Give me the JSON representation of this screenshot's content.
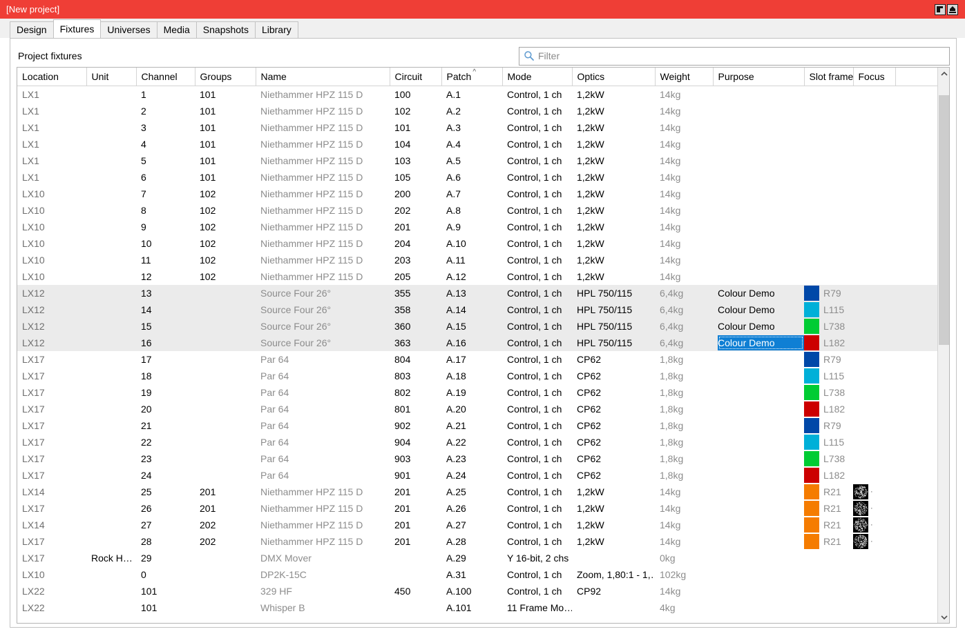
{
  "window": {
    "title": "[New project]",
    "accent_color": "#ef3e36",
    "buttons": [
      {
        "name": "restore-down-button",
        "glyph": "◤"
      },
      {
        "name": "maximize-button",
        "glyph": "⌂"
      }
    ]
  },
  "tabs": [
    {
      "label": "Design",
      "active": false
    },
    {
      "label": "Fixtures",
      "active": true
    },
    {
      "label": "Universes",
      "active": false
    },
    {
      "label": "Media",
      "active": false
    },
    {
      "label": "Snapshots",
      "active": false
    },
    {
      "label": "Library",
      "active": false
    }
  ],
  "panel": {
    "section_label": "Project fixtures",
    "filter": {
      "placeholder": "Filter",
      "value": ""
    }
  },
  "table": {
    "columns": [
      "Location",
      "Unit",
      "Channel",
      "Groups",
      "Name",
      "Circuit",
      "Patch",
      "Mode",
      "Optics",
      "Weight",
      "Purpose",
      "Slot frames",
      "Focus"
    ],
    "sorted_column": "Patch",
    "sort_direction": "asc",
    "colors": {
      "R79": "#0048a8",
      "L115": "#00b0d8",
      "L738": "#00cc33",
      "L182": "#cc0000",
      "R21": "#f57c00"
    },
    "rows": [
      {
        "location": "LX1",
        "unit": "",
        "channel": "1",
        "groups": "101",
        "name": "Niethammer HPZ 115 D",
        "circuit": "100",
        "patch": "A.1",
        "mode": "Control, 1 ch",
        "optics": "1,2kW",
        "weight": "14kg",
        "purpose": "",
        "slot_frame": "",
        "slot_color": "",
        "focus": "",
        "selected": false,
        "cell_selected": false
      },
      {
        "location": "LX1",
        "unit": "",
        "channel": "2",
        "groups": "101",
        "name": "Niethammer HPZ 115 D",
        "circuit": "102",
        "patch": "A.2",
        "mode": "Control, 1 ch",
        "optics": "1,2kW",
        "weight": "14kg",
        "purpose": "",
        "slot_frame": "",
        "slot_color": "",
        "focus": "",
        "selected": false,
        "cell_selected": false
      },
      {
        "location": "LX1",
        "unit": "",
        "channel": "3",
        "groups": "101",
        "name": "Niethammer HPZ 115 D",
        "circuit": "101",
        "patch": "A.3",
        "mode": "Control, 1 ch",
        "optics": "1,2kW",
        "weight": "14kg",
        "purpose": "",
        "slot_frame": "",
        "slot_color": "",
        "focus": "",
        "selected": false,
        "cell_selected": false
      },
      {
        "location": "LX1",
        "unit": "",
        "channel": "4",
        "groups": "101",
        "name": "Niethammer HPZ 115 D",
        "circuit": "104",
        "patch": "A.4",
        "mode": "Control, 1 ch",
        "optics": "1,2kW",
        "weight": "14kg",
        "purpose": "",
        "slot_frame": "",
        "slot_color": "",
        "focus": "",
        "selected": false,
        "cell_selected": false
      },
      {
        "location": "LX1",
        "unit": "",
        "channel": "5",
        "groups": "101",
        "name": "Niethammer HPZ 115 D",
        "circuit": "103",
        "patch": "A.5",
        "mode": "Control, 1 ch",
        "optics": "1,2kW",
        "weight": "14kg",
        "purpose": "",
        "slot_frame": "",
        "slot_color": "",
        "focus": "",
        "selected": false,
        "cell_selected": false
      },
      {
        "location": "LX1",
        "unit": "",
        "channel": "6",
        "groups": "101",
        "name": "Niethammer HPZ 115 D",
        "circuit": "105",
        "patch": "A.6",
        "mode": "Control, 1 ch",
        "optics": "1,2kW",
        "weight": "14kg",
        "purpose": "",
        "slot_frame": "",
        "slot_color": "",
        "focus": "",
        "selected": false,
        "cell_selected": false
      },
      {
        "location": "LX10",
        "unit": "",
        "channel": "7",
        "groups": "102",
        "name": "Niethammer HPZ 115 D",
        "circuit": "200",
        "patch": "A.7",
        "mode": "Control, 1 ch",
        "optics": "1,2kW",
        "weight": "14kg",
        "purpose": "",
        "slot_frame": "",
        "slot_color": "",
        "focus": "",
        "selected": false,
        "cell_selected": false
      },
      {
        "location": "LX10",
        "unit": "",
        "channel": "8",
        "groups": "102",
        "name": "Niethammer HPZ 115 D",
        "circuit": "202",
        "patch": "A.8",
        "mode": "Control, 1 ch",
        "optics": "1,2kW",
        "weight": "14kg",
        "purpose": "",
        "slot_frame": "",
        "slot_color": "",
        "focus": "",
        "selected": false,
        "cell_selected": false
      },
      {
        "location": "LX10",
        "unit": "",
        "channel": "9",
        "groups": "102",
        "name": "Niethammer HPZ 115 D",
        "circuit": "201",
        "patch": "A.9",
        "mode": "Control, 1 ch",
        "optics": "1,2kW",
        "weight": "14kg",
        "purpose": "",
        "slot_frame": "",
        "slot_color": "",
        "focus": "",
        "selected": false,
        "cell_selected": false
      },
      {
        "location": "LX10",
        "unit": "",
        "channel": "10",
        "groups": "102",
        "name": "Niethammer HPZ 115 D",
        "circuit": "204",
        "patch": "A.10",
        "mode": "Control, 1 ch",
        "optics": "1,2kW",
        "weight": "14kg",
        "purpose": "",
        "slot_frame": "",
        "slot_color": "",
        "focus": "",
        "selected": false,
        "cell_selected": false
      },
      {
        "location": "LX10",
        "unit": "",
        "channel": "11",
        "groups": "102",
        "name": "Niethammer HPZ 115 D",
        "circuit": "203",
        "patch": "A.11",
        "mode": "Control, 1 ch",
        "optics": "1,2kW",
        "weight": "14kg",
        "purpose": "",
        "slot_frame": "",
        "slot_color": "",
        "focus": "",
        "selected": false,
        "cell_selected": false
      },
      {
        "location": "LX10",
        "unit": "",
        "channel": "12",
        "groups": "102",
        "name": "Niethammer HPZ 115 D",
        "circuit": "205",
        "patch": "A.12",
        "mode": "Control, 1 ch",
        "optics": "1,2kW",
        "weight": "14kg",
        "purpose": "",
        "slot_frame": "",
        "slot_color": "",
        "focus": "",
        "selected": false,
        "cell_selected": false
      },
      {
        "location": "LX12",
        "unit": "",
        "channel": "13",
        "groups": "",
        "name": "Source Four 26°",
        "circuit": "355",
        "patch": "A.13",
        "mode": "Control, 1 ch",
        "optics": "HPL 750/115",
        "weight": "6,4kg",
        "purpose": "Colour Demo",
        "slot_frame": "R79",
        "slot_color": "#0048a8",
        "focus": "",
        "selected": true,
        "cell_selected": false
      },
      {
        "location": "LX12",
        "unit": "",
        "channel": "14",
        "groups": "",
        "name": "Source Four 26°",
        "circuit": "358",
        "patch": "A.14",
        "mode": "Control, 1 ch",
        "optics": "HPL 750/115",
        "weight": "6,4kg",
        "purpose": "Colour Demo",
        "slot_frame": "L115",
        "slot_color": "#00b0d8",
        "focus": "",
        "selected": true,
        "cell_selected": false
      },
      {
        "location": "LX12",
        "unit": "",
        "channel": "15",
        "groups": "",
        "name": "Source Four 26°",
        "circuit": "360",
        "patch": "A.15",
        "mode": "Control, 1 ch",
        "optics": "HPL 750/115",
        "weight": "6,4kg",
        "purpose": "Colour Demo",
        "slot_frame": "L738",
        "slot_color": "#00cc33",
        "focus": "",
        "selected": true,
        "cell_selected": false
      },
      {
        "location": "LX12",
        "unit": "",
        "channel": "16",
        "groups": "",
        "name": "Source Four 26°",
        "circuit": "363",
        "patch": "A.16",
        "mode": "Control, 1 ch",
        "optics": "HPL 750/115",
        "weight": "6,4kg",
        "purpose": "Colour Demo",
        "slot_frame": "L182",
        "slot_color": "#cc0000",
        "focus": "",
        "selected": true,
        "cell_selected": true
      },
      {
        "location": "LX17",
        "unit": "",
        "channel": "17",
        "groups": "",
        "name": "Par 64",
        "circuit": "804",
        "patch": "A.17",
        "mode": "Control, 1 ch",
        "optics": "CP62",
        "weight": "1,8kg",
        "purpose": "",
        "slot_frame": "R79",
        "slot_color": "#0048a8",
        "focus": "",
        "selected": false,
        "cell_selected": false
      },
      {
        "location": "LX17",
        "unit": "",
        "channel": "18",
        "groups": "",
        "name": "Par 64",
        "circuit": "803",
        "patch": "A.18",
        "mode": "Control, 1 ch",
        "optics": "CP62",
        "weight": "1,8kg",
        "purpose": "",
        "slot_frame": "L115",
        "slot_color": "#00b0d8",
        "focus": "",
        "selected": false,
        "cell_selected": false
      },
      {
        "location": "LX17",
        "unit": "",
        "channel": "19",
        "groups": "",
        "name": "Par 64",
        "circuit": "802",
        "patch": "A.19",
        "mode": "Control, 1 ch",
        "optics": "CP62",
        "weight": "1,8kg",
        "purpose": "",
        "slot_frame": "L738",
        "slot_color": "#00cc33",
        "focus": "",
        "selected": false,
        "cell_selected": false
      },
      {
        "location": "LX17",
        "unit": "",
        "channel": "20",
        "groups": "",
        "name": "Par 64",
        "circuit": "801",
        "patch": "A.20",
        "mode": "Control, 1 ch",
        "optics": "CP62",
        "weight": "1,8kg",
        "purpose": "",
        "slot_frame": "L182",
        "slot_color": "#cc0000",
        "focus": "",
        "selected": false,
        "cell_selected": false
      },
      {
        "location": "LX17",
        "unit": "",
        "channel": "21",
        "groups": "",
        "name": "Par 64",
        "circuit": "902",
        "patch": "A.21",
        "mode": "Control, 1 ch",
        "optics": "CP62",
        "weight": "1,8kg",
        "purpose": "",
        "slot_frame": "R79",
        "slot_color": "#0048a8",
        "focus": "",
        "selected": false,
        "cell_selected": false
      },
      {
        "location": "LX17",
        "unit": "",
        "channel": "22",
        "groups": "",
        "name": "Par 64",
        "circuit": "904",
        "patch": "A.22",
        "mode": "Control, 1 ch",
        "optics": "CP62",
        "weight": "1,8kg",
        "purpose": "",
        "slot_frame": "L115",
        "slot_color": "#00b0d8",
        "focus": "",
        "selected": false,
        "cell_selected": false
      },
      {
        "location": "LX17",
        "unit": "",
        "channel": "23",
        "groups": "",
        "name": "Par 64",
        "circuit": "903",
        "patch": "A.23",
        "mode": "Control, 1 ch",
        "optics": "CP62",
        "weight": "1,8kg",
        "purpose": "",
        "slot_frame": "L738",
        "slot_color": "#00cc33",
        "focus": "",
        "selected": false,
        "cell_selected": false
      },
      {
        "location": "LX17",
        "unit": "",
        "channel": "24",
        "groups": "",
        "name": "Par 64",
        "circuit": "901",
        "patch": "A.24",
        "mode": "Control, 1 ch",
        "optics": "CP62",
        "weight": "1,8kg",
        "purpose": "",
        "slot_frame": "L182",
        "slot_color": "#cc0000",
        "focus": "",
        "selected": false,
        "cell_selected": false
      },
      {
        "location": "LX14",
        "unit": "",
        "channel": "25",
        "groups": "201",
        "name": "Niethammer HPZ 115 D",
        "circuit": "201",
        "patch": "A.25",
        "mode": "Control, 1 ch",
        "optics": "1,2kW",
        "weight": "14kg",
        "purpose": "",
        "slot_frame": "R21",
        "slot_color": "#f57c00",
        "focus": "gobo",
        "selected": false,
        "cell_selected": false
      },
      {
        "location": "LX17",
        "unit": "",
        "channel": "26",
        "groups": "201",
        "name": "Niethammer HPZ 115 D",
        "circuit": "201",
        "patch": "A.26",
        "mode": "Control, 1 ch",
        "optics": "1,2kW",
        "weight": "14kg",
        "purpose": "",
        "slot_frame": "R21",
        "slot_color": "#f57c00",
        "focus": "gobo",
        "selected": false,
        "cell_selected": false
      },
      {
        "location": "LX14",
        "unit": "",
        "channel": "27",
        "groups": "202",
        "name": "Niethammer HPZ 115 D",
        "circuit": "201",
        "patch": "A.27",
        "mode": "Control, 1 ch",
        "optics": "1,2kW",
        "weight": "14kg",
        "purpose": "",
        "slot_frame": "R21",
        "slot_color": "#f57c00",
        "focus": "gobo",
        "selected": false,
        "cell_selected": false
      },
      {
        "location": "LX17",
        "unit": "",
        "channel": "28",
        "groups": "202",
        "name": "Niethammer HPZ 115 D",
        "circuit": "201",
        "patch": "A.28",
        "mode": "Control, 1 ch",
        "optics": "1,2kW",
        "weight": "14kg",
        "purpose": "",
        "slot_frame": "R21",
        "slot_color": "#f57c00",
        "focus": "gobo",
        "selected": false,
        "cell_selected": false
      },
      {
        "location": "LX17",
        "unit": "Rock H…",
        "channel": "29",
        "groups": "",
        "name": "DMX Mover",
        "circuit": "",
        "patch": "A.29",
        "mode": "Y 16-bit, 2 chs",
        "optics": "",
        "weight": "0kg",
        "purpose": "",
        "slot_frame": "",
        "slot_color": "",
        "focus": "",
        "selected": false,
        "cell_selected": false
      },
      {
        "location": "LX10",
        "unit": "",
        "channel": "0",
        "groups": "",
        "name": "DP2K-15C",
        "circuit": "",
        "patch": "A.31",
        "mode": "Control, 1 ch",
        "optics": "Zoom, 1,80:1 - 1,…",
        "weight": "102kg",
        "purpose": "",
        "slot_frame": "",
        "slot_color": "",
        "focus": "",
        "selected": false,
        "cell_selected": false
      },
      {
        "location": "LX22",
        "unit": "",
        "channel": "101",
        "groups": "",
        "name": "329 HF",
        "circuit": "450",
        "patch": "A.100",
        "mode": "Control, 1 ch",
        "optics": "CP92",
        "weight": "14kg",
        "purpose": "",
        "slot_frame": "",
        "slot_color": "",
        "focus": "",
        "selected": false,
        "cell_selected": false
      },
      {
        "location": "LX22",
        "unit": "",
        "channel": "101",
        "groups": "",
        "name": "Whisper B",
        "circuit": "",
        "patch": "A.101",
        "mode": "11 Frame Mo…",
        "optics": "",
        "weight": "4kg",
        "purpose": "",
        "slot_frame": "",
        "slot_color": "",
        "focus": "",
        "selected": false,
        "cell_selected": false
      }
    ]
  },
  "scrollbar": {
    "up_arrow": "⌃",
    "down_arrow": "⌄",
    "thumb_top_pct": 3,
    "thumb_height_pct": 47
  }
}
